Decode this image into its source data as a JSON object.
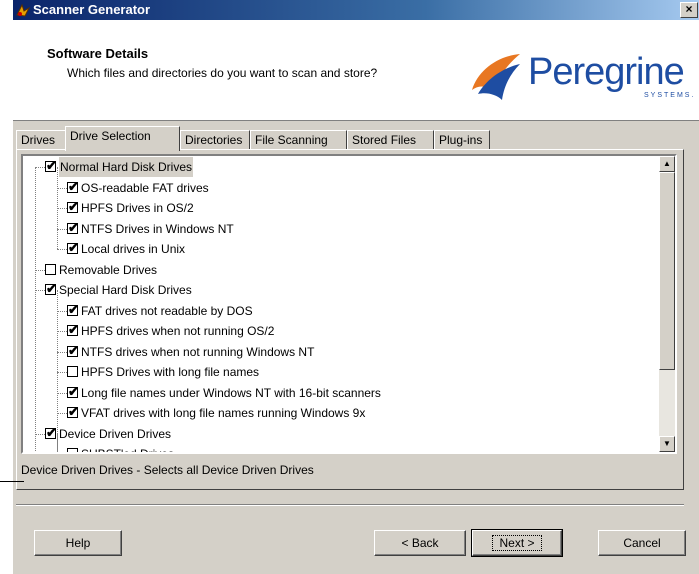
{
  "window": {
    "title": "Scanner Generator",
    "close_glyph": "×"
  },
  "header": {
    "title": "Software Details",
    "subtitle": "Which files and directories do you want to scan and store?"
  },
  "logo": {
    "name": "Peregrine",
    "tagline": "SYSTEMS."
  },
  "tabs": [
    {
      "label": "Drives"
    },
    {
      "label": "Drive Selection",
      "active": true
    },
    {
      "label": "Directories"
    },
    {
      "label": "File Scanning"
    },
    {
      "label": "Stored Files"
    },
    {
      "label": "Plug-ins"
    }
  ],
  "tree": [
    {
      "label": "Normal Hard Disk Drives",
      "checked": true,
      "level": 0,
      "selected": true
    },
    {
      "label": "OS-readable FAT drives",
      "checked": true,
      "level": 1
    },
    {
      "label": "HPFS Drives in OS/2",
      "checked": true,
      "level": 1
    },
    {
      "label": "NTFS Drives in Windows NT",
      "checked": true,
      "level": 1
    },
    {
      "label": "Local drives in Unix",
      "checked": true,
      "level": 1
    },
    {
      "label": "Removable Drives",
      "checked": false,
      "level": 0
    },
    {
      "label": "Special Hard Disk Drives",
      "checked": true,
      "level": 0
    },
    {
      "label": "FAT drives not readable by DOS",
      "checked": true,
      "level": 1
    },
    {
      "label": "HPFS drives when not running OS/2",
      "checked": true,
      "level": 1
    },
    {
      "label": "NTFS drives when not running Windows NT",
      "checked": true,
      "level": 1
    },
    {
      "label": "HPFS Drives with long file names",
      "checked": false,
      "level": 1
    },
    {
      "label": "Long file names under Windows NT with 16-bit scanners",
      "checked": true,
      "level": 1
    },
    {
      "label": "VFAT drives with long file names running Windows 9x",
      "checked": true,
      "level": 1
    },
    {
      "label": "Device Driven Drives",
      "checked": true,
      "level": 0
    },
    {
      "label": "SUBST'ed Drives",
      "checked": false,
      "level": 1
    }
  ],
  "status": "Device Driven Drives - Selects all Device Driven Drives",
  "buttons": {
    "help": "Help",
    "back": "< Back",
    "next": "Next >",
    "cancel": "Cancel"
  },
  "colors": {
    "titlebar": "#0a246a",
    "logo": "#1e4da2",
    "face": "#d4d0c8"
  }
}
